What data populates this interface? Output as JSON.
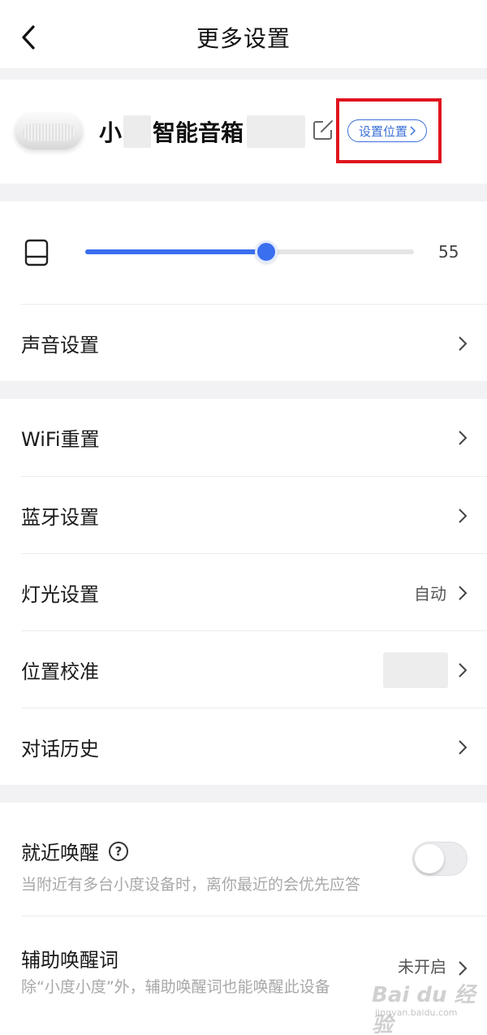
{
  "header": {
    "title": "更多设置",
    "back_icon": "chevron-left-icon"
  },
  "device": {
    "name_prefix": "小",
    "name_main": "智能音箱",
    "edit_icon": "edit-icon",
    "location_button": "设置位置",
    "location_chevron": ">"
  },
  "volume": {
    "level": 55,
    "max": 100,
    "value_text": "55",
    "icon": "speaker-icon",
    "accent": "#3a6ff0"
  },
  "sound": {
    "label": "声音设置"
  },
  "network": {
    "wifi_label": "WiFi重置",
    "bluetooth_label": "蓝牙设置",
    "light_label": "灯光设置",
    "light_value": "自动",
    "location_calibrate_label": "位置校准",
    "history_label": "对话历史"
  },
  "wake": {
    "nearby_title": "就近唤醒",
    "nearby_help": "?",
    "nearby_desc": "当附近有多台小度设备时，离你最近的会优先应答",
    "nearby_enabled": false,
    "assist_title": "辅助唤醒词",
    "assist_desc": "除“小度小度”外，辅助唤醒词也能唤醒此设备",
    "assist_value": "未开启"
  },
  "watermark": {
    "text": "Bai du 经验",
    "sub": "jingyan.baidu.com"
  },
  "colors": {
    "highlight": "#e0141e",
    "link": "#3b6fd8",
    "background": "#f2f2f4"
  }
}
